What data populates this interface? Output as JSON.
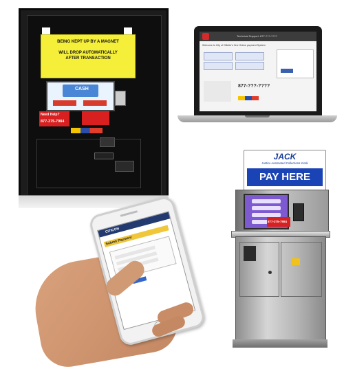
{
  "wall_unit": {
    "sign_line1": "BEING KEPT UP BY A MAGNET",
    "sign_line2": "WILL DROP AUTOMATICALLY",
    "sign_line3": "AFTER TRANSACTION",
    "screen_brand": "CASH",
    "need_help": "Need Help?",
    "phone": "877-375-7984"
  },
  "laptop": {
    "header": "Technical Support: 877-???-????",
    "welcome": "Welcome to City of Gillette's One Online payment System",
    "phone_line": "877-???-????"
  },
  "kiosk": {
    "name": "JACK",
    "tagline": "Justice Automated Collections Kiosk",
    "pay_here": "PAY HERE",
    "phone": "877-375-7984"
  },
  "phone": {
    "brand": "CITICON",
    "heading": "Submit Payment"
  }
}
